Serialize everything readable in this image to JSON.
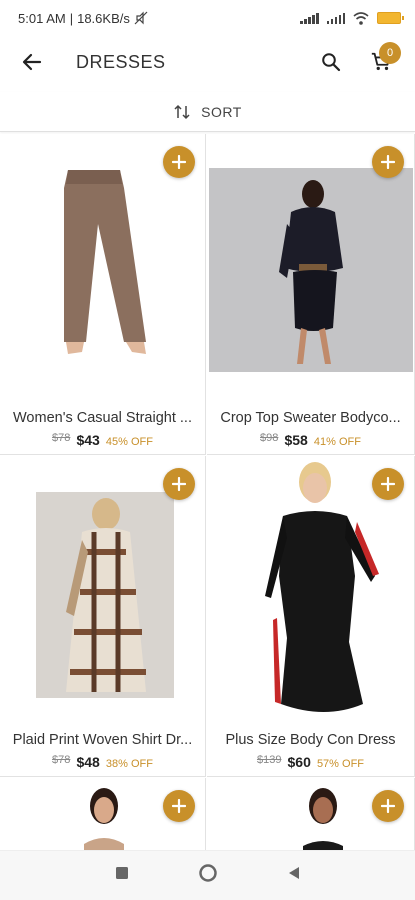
{
  "status": {
    "time": "5:01 AM",
    "speed": "18.6KB/s",
    "battery": "61"
  },
  "appbar": {
    "title": "DRESSES",
    "cart_count": "0"
  },
  "sort": {
    "label": "SORT"
  },
  "products": [
    {
      "name": "Women's Casual Straight ...",
      "original": "$78",
      "price": "$43",
      "discount": "45% OFF"
    },
    {
      "name": "Crop Top Sweater Bodyco...",
      "original": "$98",
      "price": "$58",
      "discount": "41% OFF"
    },
    {
      "name": "Plaid Print Woven Shirt Dr...",
      "original": "$78",
      "price": "$48",
      "discount": "38% OFF"
    },
    {
      "name": "Plus Size Body Con Dress",
      "original": "$139",
      "price": "$60",
      "discount": "57% OFF"
    },
    {
      "name": "",
      "original": "",
      "price": "",
      "discount": ""
    },
    {
      "name": "",
      "original": "",
      "price": "",
      "discount": ""
    }
  ],
  "colors": {
    "accent": "#c8902a"
  },
  "icons": [
    "back-arrow-icon",
    "search-icon",
    "cart-icon",
    "sort-icon",
    "plus-icon",
    "square-nav-icon",
    "circle-nav-icon",
    "triangle-back-nav-icon"
  ]
}
